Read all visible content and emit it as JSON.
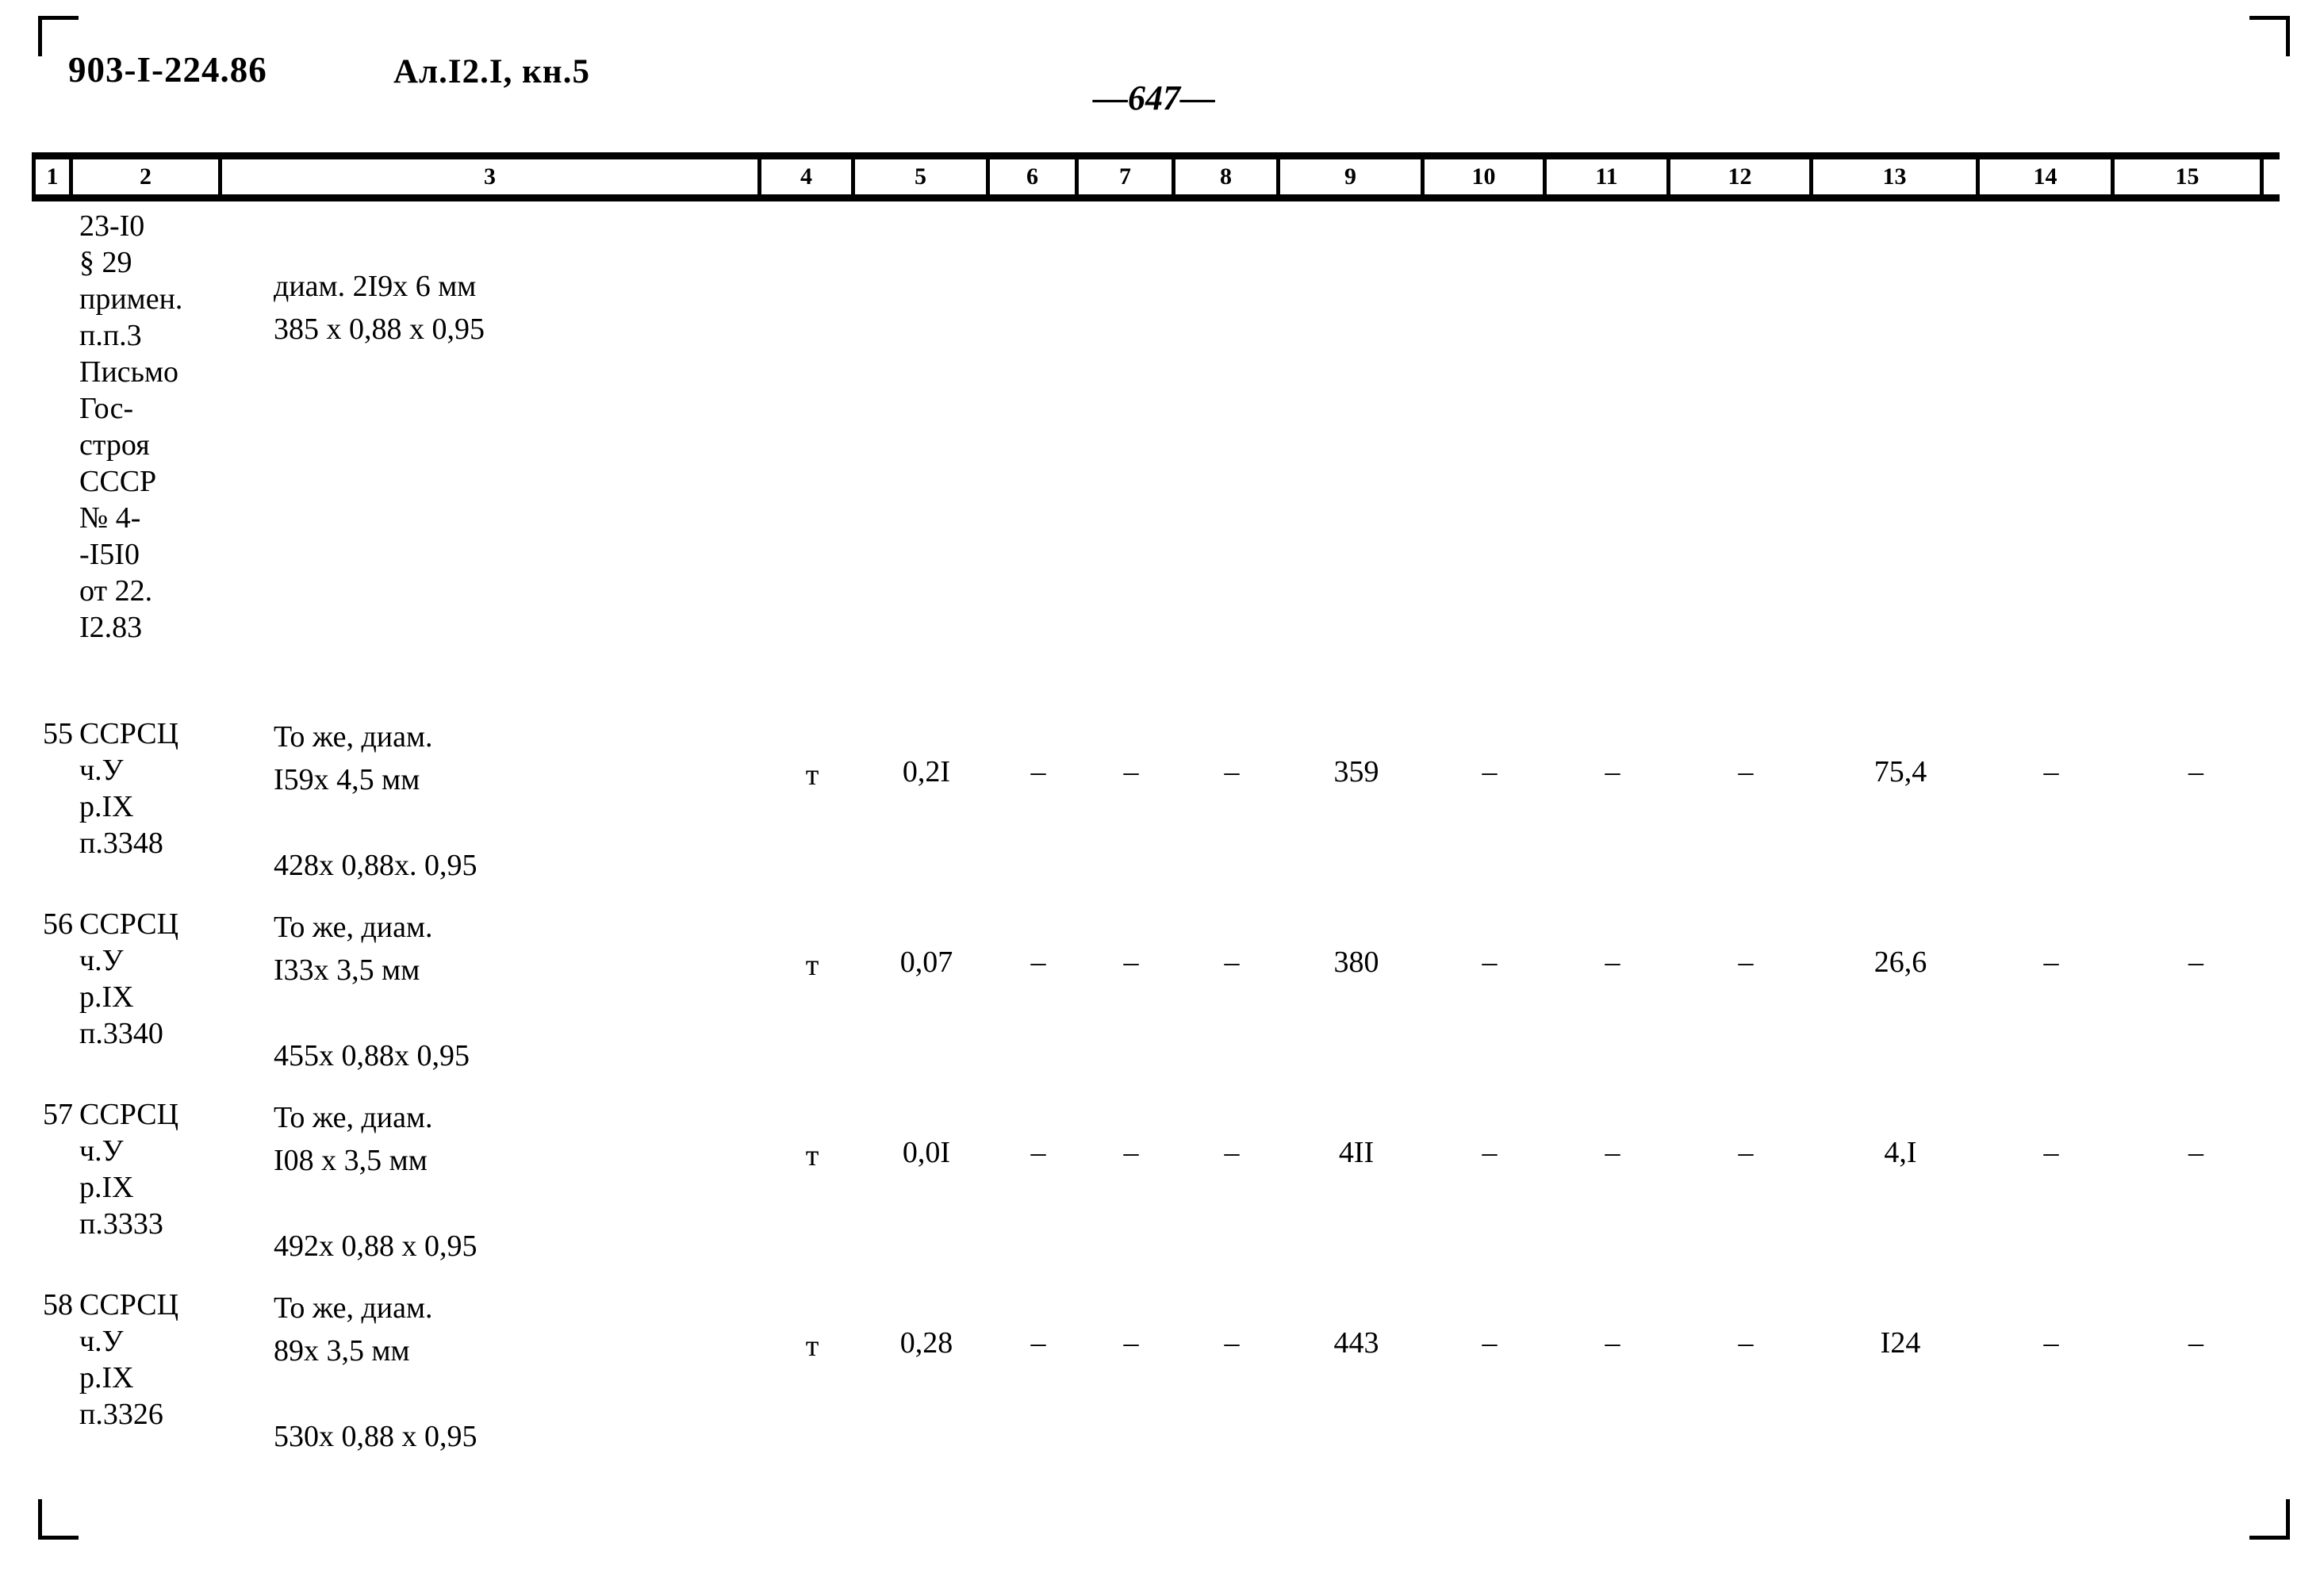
{
  "header": {
    "doc_code": "903-I-224.86",
    "album": "Ал.I2.I, кн.5",
    "page_number": "647"
  },
  "table": {
    "column_headers": [
      "1",
      "2",
      "3",
      "4",
      "5",
      "6",
      "7",
      "8",
      "9",
      "10",
      "11",
      "12",
      "13",
      "14",
      "15"
    ],
    "rows": [
      {
        "c1": "",
        "c2": "23-I0\n§ 29\nпримен.\nп.п.3\nПисьмо\nГос-\nстроя\nСССР\n№ 4-\n-I5I0\nот 22.\nI2.83",
        "c3": "диам. 2I9x 6 мм\n385 x 0,88 x 0,95",
        "c4": "",
        "c5": "",
        "c6": "",
        "c7": "",
        "c8": "",
        "c9": "",
        "c10": "",
        "c11": "",
        "c12": "",
        "c13": "",
        "c14": "",
        "c15": ""
      },
      {
        "c1": "55",
        "c2": "ССРСЦ\nч.У\nр.IX\nп.3348",
        "c3": "То же, диам.\nI59x 4,5 мм\n\n428x 0,88x. 0,95",
        "c4": "т",
        "c5": "0,2I",
        "c6": "–",
        "c7": "–",
        "c8": "–",
        "c9": "359",
        "c10": "–",
        "c11": "–",
        "c12": "–",
        "c13": "75,4",
        "c14": "–",
        "c15": "–"
      },
      {
        "c1": "56",
        "c2": "ССРСЦ\nч.У\nр.IX\nп.3340",
        "c3": "То же, диам.\nI33x 3,5 мм\n\n455x 0,88x 0,95",
        "c4": "т",
        "c5": "0,07",
        "c6": "–",
        "c7": "–",
        "c8": "–",
        "c9": "380",
        "c10": "–",
        "c11": "–",
        "c12": "–",
        "c13": "26,6",
        "c14": "–",
        "c15": "–"
      },
      {
        "c1": "57",
        "c2": "ССРСЦ\nч.У\nр.IX\nп.3333",
        "c3": "То же, диам.\nI08 x 3,5 мм\n\n492x 0,88 x 0,95",
        "c4": "т",
        "c5": "0,0I",
        "c6": "–",
        "c7": "–",
        "c8": "–",
        "c9": "4II",
        "c10": "–",
        "c11": "–",
        "c12": "–",
        "c13": "4,I",
        "c14": "–",
        "c15": "–"
      },
      {
        "c1": "58",
        "c2": "ССРСЦ\nч.У\nр.IX\nп.3326",
        "c3": "То же, диам.\n89x 3,5 мм\n\n530x 0,88 x 0,95",
        "c4": "т",
        "c5": "0,28",
        "c6": "–",
        "c7": "–",
        "c8": "–",
        "c9": "443",
        "c10": "–",
        "c11": "–",
        "c12": "–",
        "c13": "I24",
        "c14": "–",
        "c15": "–"
      }
    ]
  }
}
